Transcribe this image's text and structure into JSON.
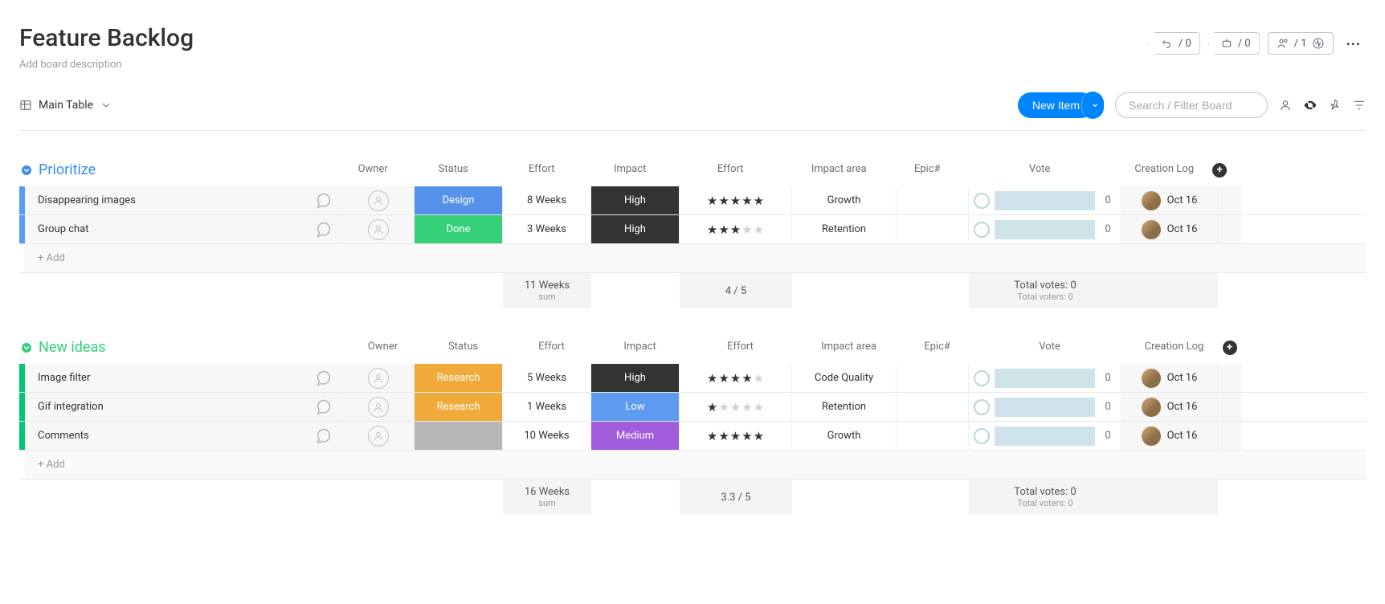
{
  "header": {
    "title": "Feature Backlog",
    "subtitle": "Add board description",
    "integrations_count": "/ 0",
    "automations_count": "/ 0",
    "members_count": "/ 1"
  },
  "view": {
    "name": "Main Table"
  },
  "toolbar": {
    "new_item_label": "New Item",
    "search_placeholder": "Search / Filter Board"
  },
  "columns": {
    "owner": "Owner",
    "status": "Status",
    "effort": "Effort",
    "impact": "Impact",
    "effort2": "Effort",
    "impact_area": "Impact area",
    "epic": "Epic#",
    "vote": "Vote",
    "creation_log": "Creation Log"
  },
  "groups": [
    {
      "id": "prioritize",
      "title": "Prioritize",
      "color": "#3b8af2",
      "bar_class": "cb-blue",
      "bar_light_class": "cb-blue-light",
      "rows": [
        {
          "name": "Disappearing images",
          "status": "Design",
          "status_class": "st-design",
          "effort": "8 Weeks",
          "impact": "High",
          "impact_class": "imp-high",
          "stars": 5,
          "impact_area": "Growth",
          "epic": "",
          "votes": 0,
          "date": "Oct 16"
        },
        {
          "name": "Group chat",
          "status": "Done",
          "status_class": "st-done",
          "effort": "3 Weeks",
          "impact": "High",
          "impact_class": "imp-high",
          "stars": 3,
          "impact_area": "Retention",
          "epic": "",
          "votes": 0,
          "date": "Oct 16"
        }
      ],
      "summary": {
        "effort": "11 Weeks",
        "effort_sub": "sum",
        "rating": "4 / 5",
        "votes_total": "Total votes: 0",
        "voters_total": "Total voters: 0"
      },
      "add_label": "+ Add"
    },
    {
      "id": "new-ideas",
      "title": "New ideas",
      "color": "#33d078",
      "bar_class": "cb-green",
      "bar_light_class": "cb-green-light",
      "rows": [
        {
          "name": "Image filter",
          "status": "Research",
          "status_class": "st-research",
          "effort": "5 Weeks",
          "impact": "High",
          "impact_class": "imp-high",
          "stars": 4,
          "impact_area": "Code Quality",
          "epic": "",
          "votes": 0,
          "date": "Oct 16"
        },
        {
          "name": "Gif integration",
          "status": "Research",
          "status_class": "st-research",
          "effort": "1 Weeks",
          "impact": "Low",
          "impact_class": "imp-low",
          "stars": 1,
          "impact_area": "Retention",
          "epic": "",
          "votes": 0,
          "date": "Oct 16"
        },
        {
          "name": "Comments",
          "status": "",
          "status_class": "st-blank",
          "effort": "10 Weeks",
          "impact": "Medium",
          "impact_class": "imp-medium",
          "stars": 5,
          "impact_area": "Growth",
          "epic": "",
          "votes": 0,
          "date": "Oct 16"
        }
      ],
      "summary": {
        "effort": "16 Weeks",
        "effort_sub": "sum",
        "rating": "3.3 / 5",
        "votes_total": "Total votes: 0",
        "voters_total": "Total voters: 0"
      },
      "add_label": "+ Add"
    }
  ]
}
